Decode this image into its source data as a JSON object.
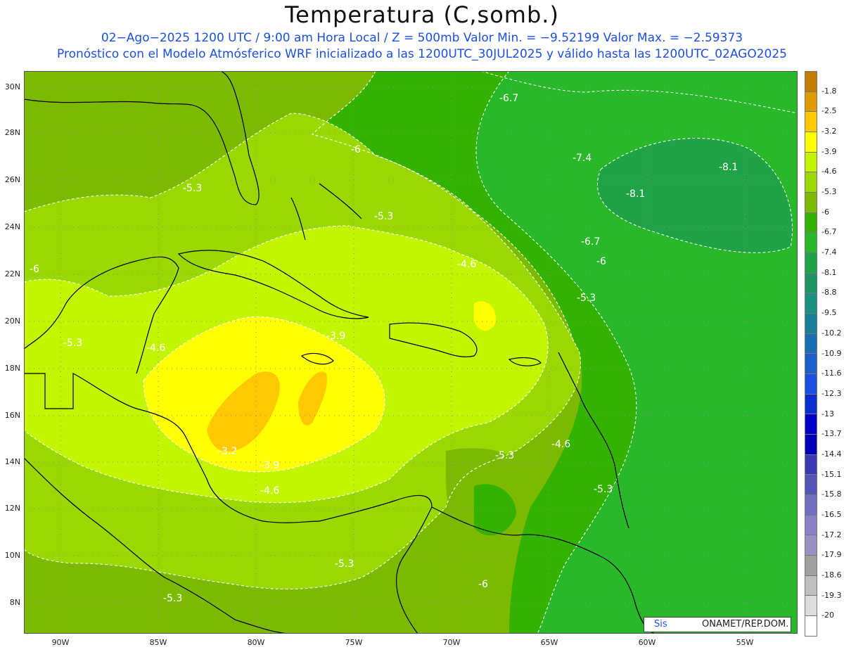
{
  "title": "Temperatura (C,somb.)",
  "subtitle_line1": "02−Ago−2025  1200 UTC / 9:00 am Hora Local / Z = 500mb  Valor Min. = −9.52199  Valor Max. = −2.59373",
  "subtitle_line2": "Pronóstico con el Modelo Atmósferico WRF inicializado a las 1200UTC_30JUL2025 y válido hasta las  1200UTC_02AGO2025",
  "lat_labels": [
    "30N",
    "28N",
    "26N",
    "24N",
    "22N",
    "20N",
    "18N",
    "16N",
    "14N",
    "12N",
    "10N",
    "8N"
  ],
  "lon_labels": [
    "90W",
    "85W",
    "80W",
    "75W",
    "70W",
    "65W",
    "60W",
    "55W"
  ],
  "colorbar": {
    "labels": [
      "-1.8",
      "-2.5",
      "-3.2",
      "-3.9",
      "-4.6",
      "-5.3",
      "-6",
      "-6.7",
      "-7.4",
      "-8.1",
      "-8.8",
      "-9.5",
      "-10.2",
      "-10.9",
      "-11.6",
      "-12.3",
      "-13",
      "-13.7",
      "-14.4",
      "-15.1",
      "-15.8",
      "-16.5",
      "-17.2",
      "-17.9",
      "-18.6",
      "-19.3",
      "-20"
    ],
    "colors": [
      "#c27c00",
      "#e09a00",
      "#ffc800",
      "#ffff00",
      "#c3f500",
      "#99d900",
      "#7cba00",
      "#33b300",
      "#29b829",
      "#1fa346",
      "#1e9463",
      "#199080",
      "#1a8099",
      "#1a6fb3",
      "#1a5fcc",
      "#1a4fe0",
      "#0a2fd0",
      "#0000cc",
      "#0000b8",
      "#3a3ab5",
      "#5555b8",
      "#7070c0",
      "#8a80c4",
      "#9a90c4",
      "#a0a0a0",
      "#bfbfbf",
      "#dcdcdc",
      "#ffffff"
    ]
  },
  "contour_labels": [
    {
      "text": "-6.7"
    },
    {
      "text": "-6"
    },
    {
      "text": "-7.4"
    },
    {
      "text": "-8.1"
    },
    {
      "text": "-8.1"
    },
    {
      "text": "-5.3"
    },
    {
      "text": "-5.3"
    },
    {
      "text": "-6.7"
    },
    {
      "text": "-6"
    },
    {
      "text": "-6"
    },
    {
      "text": "-4.6"
    },
    {
      "text": "-5.3"
    },
    {
      "text": "-5.3"
    },
    {
      "text": "-4.6"
    },
    {
      "text": "-3.9"
    },
    {
      "text": "-3.2"
    },
    {
      "text": "-3.9"
    },
    {
      "text": "-4.6"
    },
    {
      "text": "-5.3"
    },
    {
      "text": "-4.6"
    },
    {
      "text": "-5.3"
    },
    {
      "text": "-5.3"
    },
    {
      "text": "-6"
    },
    {
      "text": "-5.3"
    }
  ],
  "credit": {
    "left": "Sis",
    "right": "ONAMET/REP.DOM."
  }
}
